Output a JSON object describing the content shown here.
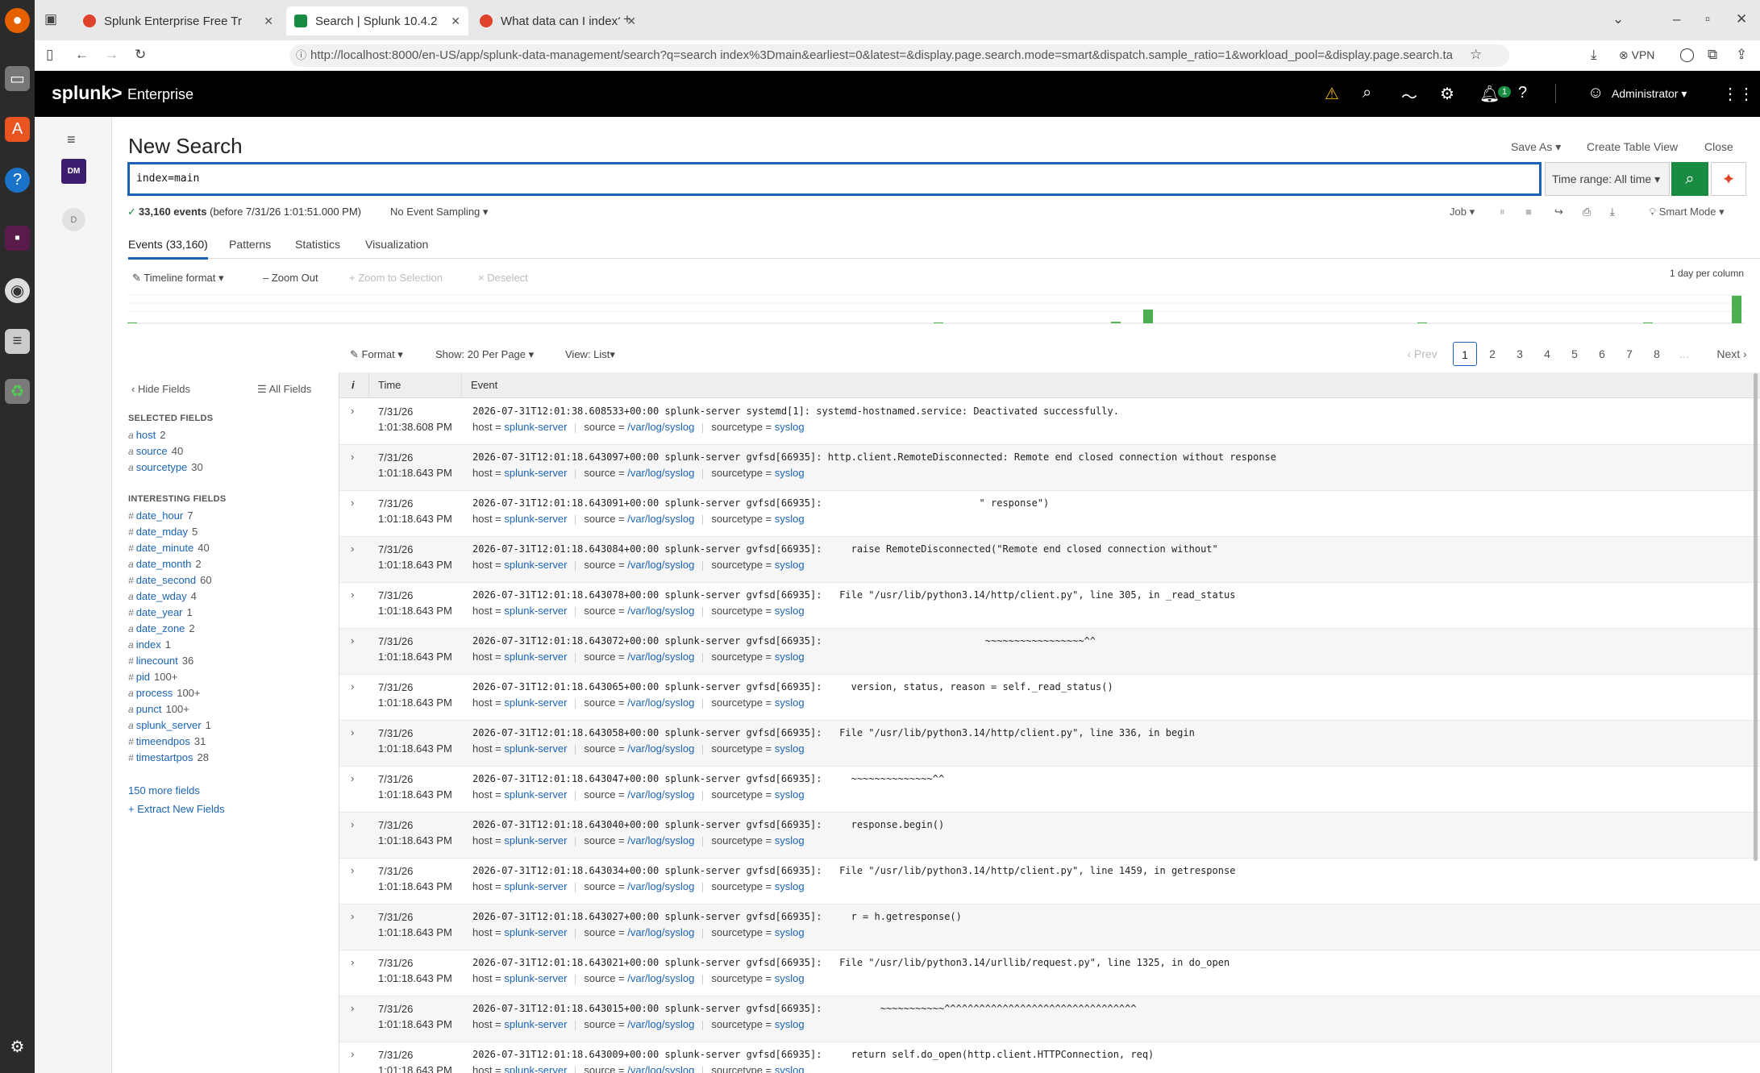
{
  "browser": {
    "tabs": [
      {
        "title": "Splunk Enterprise Free Tr",
        "active": false
      },
      {
        "title": "Search | Splunk 10.4.2",
        "active": true
      },
      {
        "title": "What data can I index? | S",
        "active": false
      }
    ],
    "url": "http://localhost:8000/en-US/app/splunk-data-management/search?q=search index%3Dmain&earliest=0&latest=&display.page.search.mode=smart&dispatch.sample_ratio=1&workload_pool=&display.page.search.ta",
    "vpn_label": "VPN"
  },
  "splunk": {
    "logo": "splunk>",
    "edition": "Enterprise",
    "notification_count": "1",
    "user": "Administrator",
    "app_dm": "DM",
    "app_d": "D"
  },
  "search": {
    "title": "New Search",
    "save_as": "Save As",
    "create_table": "Create Table View",
    "close": "Close",
    "query": "index=main",
    "time_range": "Time range: All time",
    "event_count": "33,160 events",
    "event_before": "(before 7/31/26 1:01:51.000 PM)",
    "sampling": "No Event Sampling",
    "job": "Job",
    "mode": "Smart Mode"
  },
  "tabs": [
    "Events (33,160)",
    "Patterns",
    "Statistics",
    "Visualization"
  ],
  "timeline": {
    "format": "Timeline format",
    "zoom_out": "Zoom Out",
    "zoom_sel": "+ Zoom to Selection",
    "deselect": "Deselect",
    "column_note": "1 day per column",
    "bars": [
      0.02,
      0,
      0,
      0,
      0,
      0.02,
      0.05,
      0.45,
      0.01,
      0.02,
      0.9
    ]
  },
  "results": {
    "format": "Format",
    "show": "Show: 20 Per Page",
    "view": "View: List",
    "prev": "Prev",
    "next": "Next",
    "pages": [
      "1",
      "2",
      "3",
      "4",
      "5",
      "6",
      "7",
      "8",
      "..."
    ]
  },
  "fields": {
    "hide": "Hide Fields",
    "all": "All Fields",
    "selected_title": "SELECTED FIELDS",
    "selected": [
      {
        "type": "a",
        "name": "host",
        "count": "2"
      },
      {
        "type": "a",
        "name": "source",
        "count": "40"
      },
      {
        "type": "a",
        "name": "sourcetype",
        "count": "30"
      }
    ],
    "interesting_title": "INTERESTING FIELDS",
    "interesting": [
      {
        "type": "#",
        "name": "date_hour",
        "count": "7"
      },
      {
        "type": "#",
        "name": "date_mday",
        "count": "5"
      },
      {
        "type": "#",
        "name": "date_minute",
        "count": "40"
      },
      {
        "type": "a",
        "name": "date_month",
        "count": "2"
      },
      {
        "type": "#",
        "name": "date_second",
        "count": "60"
      },
      {
        "type": "a",
        "name": "date_wday",
        "count": "4"
      },
      {
        "type": "#",
        "name": "date_year",
        "count": "1"
      },
      {
        "type": "a",
        "name": "date_zone",
        "count": "2"
      },
      {
        "type": "a",
        "name": "index",
        "count": "1"
      },
      {
        "type": "#",
        "name": "linecount",
        "count": "36"
      },
      {
        "type": "#",
        "name": "pid",
        "count": "100+"
      },
      {
        "type": "a",
        "name": "process",
        "count": "100+"
      },
      {
        "type": "a",
        "name": "punct",
        "count": "100+"
      },
      {
        "type": "a",
        "name": "splunk_server",
        "count": "1"
      },
      {
        "type": "#",
        "name": "timeendpos",
        "count": "31"
      },
      {
        "type": "#",
        "name": "timestartpos",
        "count": "28"
      }
    ],
    "more": "150 more fields",
    "extract": "+ Extract New Fields"
  },
  "events": {
    "col_info": "i",
    "col_time": "Time",
    "col_event": "Event",
    "meta": {
      "host_key": "host =",
      "source_key": "source =",
      "sourcetype_key": "sourcetype ="
    },
    "rows": [
      {
        "date": "7/31/26",
        "time": "1:01:38.608 PM",
        "raw": "2026-07-31T12:01:38.608533+00:00 splunk-server systemd[1]: systemd-hostnamed.service: Deactivated successfully.",
        "host": "splunk-server",
        "source": "/var/log/syslog",
        "sourcetype": "syslog"
      },
      {
        "date": "7/31/26",
        "time": "1:01:18.643 PM",
        "raw": "2026-07-31T12:01:18.643097+00:00 splunk-server gvfsd[66935]: http.client.RemoteDisconnected: Remote end closed connection without response",
        "host": "splunk-server",
        "source": "/var/log/syslog",
        "sourcetype": "syslog"
      },
      {
        "date": "7/31/26",
        "time": "1:01:18.643 PM",
        "raw": "2026-07-31T12:01:18.643091+00:00 splunk-server gvfsd[66935]:                           \" response\")",
        "host": "splunk-server",
        "source": "/var/log/syslog",
        "sourcetype": "syslog"
      },
      {
        "date": "7/31/26",
        "time": "1:01:18.643 PM",
        "raw": "2026-07-31T12:01:18.643084+00:00 splunk-server gvfsd[66935]:     raise RemoteDisconnected(\"Remote end closed connection without\"",
        "host": "splunk-server",
        "source": "/var/log/syslog",
        "sourcetype": "syslog"
      },
      {
        "date": "7/31/26",
        "time": "1:01:18.643 PM",
        "raw": "2026-07-31T12:01:18.643078+00:00 splunk-server gvfsd[66935]:   File \"/usr/lib/python3.14/http/client.py\", line 305, in _read_status",
        "host": "splunk-server",
        "source": "/var/log/syslog",
        "sourcetype": "syslog"
      },
      {
        "date": "7/31/26",
        "time": "1:01:18.643 PM",
        "raw": "2026-07-31T12:01:18.643072+00:00 splunk-server gvfsd[66935]:                            ~~~~~~~~~~~~~~~~~^^",
        "host": "splunk-server",
        "source": "/var/log/syslog",
        "sourcetype": "syslog"
      },
      {
        "date": "7/31/26",
        "time": "1:01:18.643 PM",
        "raw": "2026-07-31T12:01:18.643065+00:00 splunk-server gvfsd[66935]:     version, status, reason = self._read_status()",
        "host": "splunk-server",
        "source": "/var/log/syslog",
        "sourcetype": "syslog"
      },
      {
        "date": "7/31/26",
        "time": "1:01:18.643 PM",
        "raw": "2026-07-31T12:01:18.643058+00:00 splunk-server gvfsd[66935]:   File \"/usr/lib/python3.14/http/client.py\", line 336, in begin",
        "host": "splunk-server",
        "source": "/var/log/syslog",
        "sourcetype": "syslog"
      },
      {
        "date": "7/31/26",
        "time": "1:01:18.643 PM",
        "raw": "2026-07-31T12:01:18.643047+00:00 splunk-server gvfsd[66935]:     ~~~~~~~~~~~~~~^^",
        "host": "splunk-server",
        "source": "/var/log/syslog",
        "sourcetype": "syslog"
      },
      {
        "date": "7/31/26",
        "time": "1:01:18.643 PM",
        "raw": "2026-07-31T12:01:18.643040+00:00 splunk-server gvfsd[66935]:     response.begin()",
        "host": "splunk-server",
        "source": "/var/log/syslog",
        "sourcetype": "syslog"
      },
      {
        "date": "7/31/26",
        "time": "1:01:18.643 PM",
        "raw": "2026-07-31T12:01:18.643034+00:00 splunk-server gvfsd[66935]:   File \"/usr/lib/python3.14/http/client.py\", line 1459, in getresponse",
        "host": "splunk-server",
        "source": "/var/log/syslog",
        "sourcetype": "syslog"
      },
      {
        "date": "7/31/26",
        "time": "1:01:18.643 PM",
        "raw": "2026-07-31T12:01:18.643027+00:00 splunk-server gvfsd[66935]:     r = h.getresponse()",
        "host": "splunk-server",
        "source": "/var/log/syslog",
        "sourcetype": "syslog"
      },
      {
        "date": "7/31/26",
        "time": "1:01:18.643 PM",
        "raw": "2026-07-31T12:01:18.643021+00:00 splunk-server gvfsd[66935]:   File \"/usr/lib/python3.14/urllib/request.py\", line 1325, in do_open",
        "host": "splunk-server",
        "source": "/var/log/syslog",
        "sourcetype": "syslog"
      },
      {
        "date": "7/31/26",
        "time": "1:01:18.643 PM",
        "raw": "2026-07-31T12:01:18.643015+00:00 splunk-server gvfsd[66935]:          ~~~~~~~~~~~^^^^^^^^^^^^^^^^^^^^^^^^^^^^^^^^^",
        "host": "splunk-server",
        "source": "/var/log/syslog",
        "sourcetype": "syslog"
      },
      {
        "date": "7/31/26",
        "time": "1:01:18.643 PM",
        "raw": "2026-07-31T12:01:18.643009+00:00 splunk-server gvfsd[66935]:     return self.do_open(http.client.HTTPConnection, req)",
        "host": "splunk-server",
        "source": "/var/log/syslog",
        "sourcetype": "syslog"
      }
    ]
  },
  "colors": {
    "accent": "#1a63b5",
    "search_green": "#1a8c42",
    "timeline_green": "#4caf50"
  }
}
